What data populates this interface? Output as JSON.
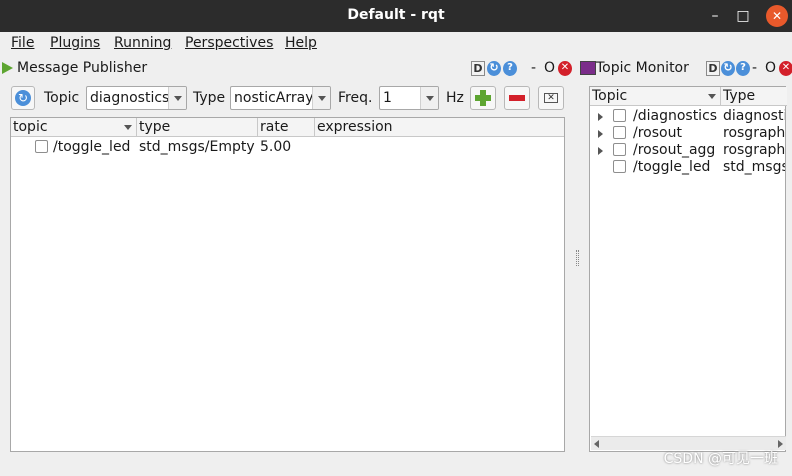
{
  "window": {
    "title": "Default - rqt",
    "minimize": "–",
    "maximize": "□",
    "close": "✕"
  },
  "menu": [
    "File",
    "Plugins",
    "Running",
    "Perspectives",
    "Help"
  ],
  "publisher": {
    "title": "Message Publisher",
    "dock_buttons": {
      "d": "D",
      "help": "?",
      "o": "O",
      "close": "✕",
      "dash": "-"
    },
    "topic_label": "Topic",
    "topic_value": "diagnostics",
    "type_label": "Type",
    "type_value": "nosticArray",
    "freq_label": "Freq.",
    "freq_value": "1",
    "hz_label": "Hz",
    "columns": [
      "topic",
      "type",
      "rate",
      "expression"
    ],
    "rows": [
      {
        "topic": "/toggle_led",
        "type": "std_msgs/Empty",
        "rate": "5.00",
        "expression": ""
      }
    ]
  },
  "monitor": {
    "title": "Topic Monitor",
    "dock_buttons": {
      "d": "D",
      "help": "?",
      "dash": "-",
      "o": "O",
      "close": "✕"
    },
    "columns": [
      "Topic",
      "Type"
    ],
    "rows": [
      {
        "topic": "/diagnostics",
        "type": "diagnosti",
        "expandable": true
      },
      {
        "topic": "/rosout",
        "type": "rosgraph_",
        "expandable": true
      },
      {
        "topic": "/rosout_agg",
        "type": "rosgraph_",
        "expandable": true
      },
      {
        "topic": "/toggle_led",
        "type": "std_msgs",
        "expandable": false
      }
    ]
  },
  "watermark": "CSDN @可见一班",
  "colors": {
    "titlebar": "#2c2c2c",
    "close": "#e8592b",
    "accent": "#4b8fd9",
    "add": "#5da531",
    "remove": "#d3202a"
  }
}
